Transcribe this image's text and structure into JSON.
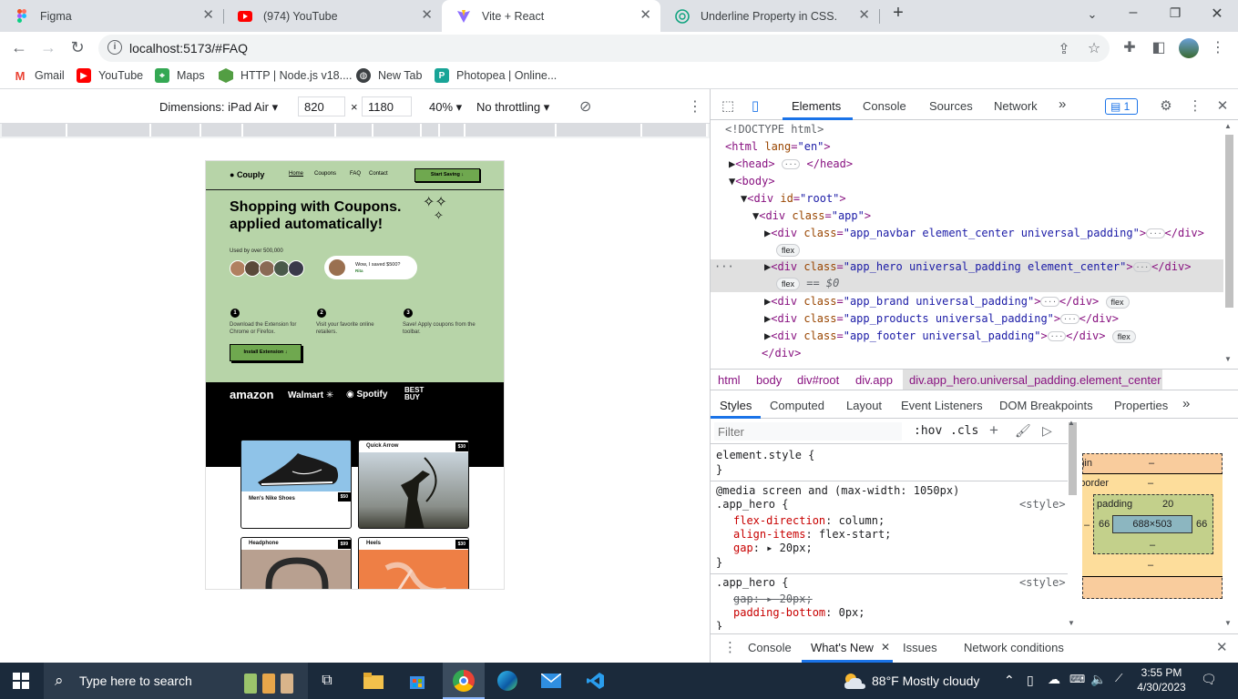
{
  "tabs": [
    {
      "title": "Figma",
      "icon": "figma-icon"
    },
    {
      "title": "(974) YouTube",
      "icon": "youtube-icon"
    },
    {
      "title": "Vite + React",
      "icon": "vite-icon"
    },
    {
      "title": "Underline Property in CSS.",
      "icon": "chatgpt-icon"
    }
  ],
  "address": {
    "url": "localhost:5173/#FAQ"
  },
  "bookmarks": [
    {
      "label": "Gmail",
      "icon": "gmail-icon"
    },
    {
      "label": "YouTube",
      "icon": "youtube-icon"
    },
    {
      "label": "Maps",
      "icon": "maps-icon"
    },
    {
      "label": "HTTP | Node.js v18....",
      "icon": "nodejs-icon"
    },
    {
      "label": "New Tab",
      "icon": "globe-icon"
    },
    {
      "label": "Photopea | Online...",
      "icon": "photopea-icon"
    }
  ],
  "device_toolbar": {
    "dimensions": "Dimensions: iPad Air",
    "width": "820",
    "height": "1180",
    "times": "×",
    "zoom": "40%",
    "throttling": "No throttling"
  },
  "site": {
    "brand": "Couply",
    "nav": [
      "Home",
      "Coupons",
      "FAQ",
      "Contact"
    ],
    "cta": "Start Saving ↓",
    "headline1": "Shopping with Coupons.",
    "headline2": "applied automatically!",
    "used_by": "Used by over 500,000",
    "testimonial": "Wow, I saved $500?",
    "testimonial_name": "Rita",
    "steps": [
      {
        "n": "1",
        "text": "Download the Extension for Chrome or Firefox."
      },
      {
        "n": "2",
        "text": "Visit your favorite online retailers."
      },
      {
        "n": "3",
        "text": "Save! Apply coupons from the toolbar."
      }
    ],
    "install": "Install Extension ↓",
    "brands": [
      "amazon",
      "Walmart",
      "Spotify",
      "BEST BUY"
    ],
    "products": [
      {
        "name": "Men's Nike Shoes",
        "price": "$50"
      },
      {
        "name": "Quick Arrow",
        "price": "$30"
      },
      {
        "name": "Headphone",
        "price": "$99"
      },
      {
        "name": "Heels",
        "price": "$30"
      }
    ]
  },
  "devtools": {
    "tabs": [
      "Elements",
      "Console",
      "Sources",
      "Network",
      "»"
    ],
    "issues_count": "1",
    "dom": {
      "l1": "<!DOCTYPE html>",
      "l2_tag": "<html ",
      "l2_attr": "lang",
      "l2_val": "\"en\"",
      "l2_end": ">",
      "l3": "<head>",
      "l3_end": "</head>",
      "l4": "<body>",
      "l5_tag": "<div ",
      "l5_attr": "id",
      "l5_val": "\"root\"",
      "l5_end": ">",
      "l6_tag": "<div ",
      "l6_attr": "class",
      "l6_val": "\"app\"",
      "l6_end": ">",
      "l7_val": "\"app_navbar element_center universal_padding\"",
      "l8_val": "\"app_hero universal_padding element_center\"",
      "l8_sel": "== $0",
      "l9_val": "\"app_brand universal_padding\"",
      "l10_val": "\"app_products universal_padding\"",
      "l11_val": "\"app_footer universal_padding\"",
      "l12": "</div>",
      "flex": "flex",
      "div_open": "<div ",
      "class_attr": "class",
      "div_close": "</div>",
      "gt": ">",
      "dots": "···"
    },
    "breadcrumbs": [
      "html",
      "body",
      "div#root",
      "div.app",
      "div.app_hero.universal_padding.element_center"
    ],
    "styles_tabs": [
      "Styles",
      "Computed",
      "Layout",
      "Event Listeners",
      "DOM Breakpoints",
      "Properties",
      "»"
    ],
    "filter_placeholder": "Filter",
    "hov": ":hov",
    "cls": ".cls",
    "styles": {
      "element_style": "element.style {",
      "close": "}",
      "media": "@media screen and (max-width: 1050px)",
      "rule1_sel": ".app_hero {",
      "rule1_src": "<style>",
      "r1p1": "flex-direction",
      "r1v1": "column;",
      "r1p2": "align-items",
      "r1v2": "flex-start;",
      "r1p3": "gap",
      "r1v3": "20px;",
      "rule2_sel": ".app_hero {",
      "rule2_src": "<style>",
      "r2p1": "gap",
      "r2v1": "20px;",
      "r2p2": "padding-bottom",
      "r2v2": "0px;"
    },
    "box_model": {
      "margin_label": "margin",
      "border_label": "border",
      "padding_label": "padding",
      "padding_value": "20",
      "left": "66",
      "right": "66",
      "content": "688×503",
      "dash": "–"
    },
    "drawer_tabs": [
      "Console",
      "What's New",
      "Issues",
      "Network conditions"
    ]
  },
  "taskbar": {
    "search": "Type here to search",
    "weather": "88°F  Mostly cloudy",
    "time": "3:55 PM",
    "date": "4/30/2023"
  },
  "colors": {
    "hero_green": "#b7d4a8",
    "chrome_tabstrip": "#dee1e6",
    "devtools_tag": "#881280",
    "taskbar": "#1b2a3b"
  }
}
